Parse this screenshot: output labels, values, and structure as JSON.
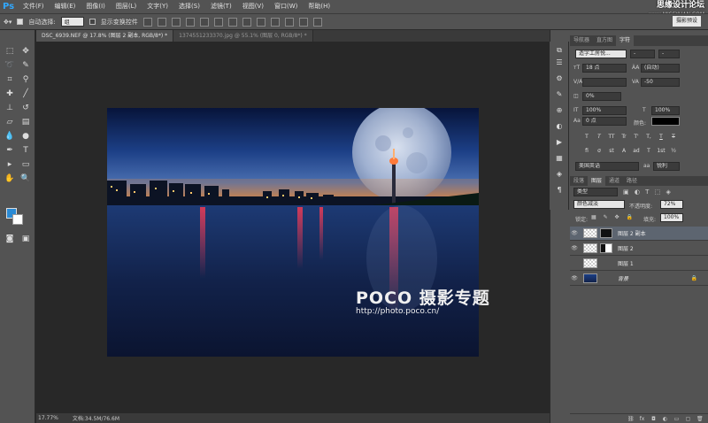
{
  "app": {
    "logo": "Ps"
  },
  "menu": [
    "文件(F)",
    "编辑(E)",
    "图像(I)",
    "图层(L)",
    "文字(Y)",
    "选择(S)",
    "滤镜(T)",
    "视图(V)",
    "窗口(W)",
    "帮助(H)"
  ],
  "watermark": {
    "title": "思缘设计论坛",
    "url": "www.MISSYUAN.COM"
  },
  "options": {
    "auto_select_label": "自动选择:",
    "auto_select_value": "组",
    "show_transform_label": "显示变换控件"
  },
  "workspace": {
    "value": "摄影预设"
  },
  "tabs": [
    {
      "label": "DSC_6939.NEF @ 17.8% (图层 2 副本, RGB/8*) *",
      "active": true
    },
    {
      "label": "1374551233370.jpg @ 55.1% (图层 0, RGB/8*) *",
      "active": false
    }
  ],
  "canvas": {
    "poco_brand": "POCO 摄影专题",
    "poco_url": "http://photo.poco.cn/"
  },
  "status": {
    "zoom": "17.77%",
    "doc": "文档:34.5M/76.6M"
  },
  "character_panel": {
    "tabs": [
      "导航器",
      "直方图",
      "字符"
    ],
    "font_family": "造字工房悦...",
    "font_size": "18 点",
    "leading": "(自动)",
    "tracking": "-50",
    "kerning": "0%",
    "vscale": "100%",
    "hscale": "100%",
    "baseline": "0 点",
    "color_label": "颜色:",
    "style_buttons": [
      "T",
      "T",
      "TT",
      "Tr",
      "T'",
      "T,",
      "T",
      "T"
    ],
    "feature_buttons": [
      "fi",
      "σ",
      "st",
      "A",
      "ad",
      "T",
      "1st",
      "½"
    ],
    "language": "美国英语",
    "aa_label": "aa",
    "aa_value": "锐利"
  },
  "layers_panel": {
    "tabs": [
      "段落",
      "图层",
      "通道",
      "路径"
    ],
    "kind_filter": "类型",
    "blend_mode": "颜色减淡",
    "opacity_label": "不透明度:",
    "opacity": "72%",
    "lock_label": "锁定:",
    "fill_label": "填充:",
    "fill": "100%",
    "layers": [
      {
        "name": "图层 2 副本",
        "selected": true,
        "visible": true,
        "has_mask": true
      },
      {
        "name": "图层 2",
        "selected": false,
        "visible": true,
        "has_mask": true
      },
      {
        "name": "图层 1",
        "selected": false,
        "visible": false,
        "has_mask": false
      },
      {
        "name": "背景",
        "selected": false,
        "visible": true,
        "has_mask": false,
        "locked": true
      }
    ]
  },
  "colors": {
    "foreground": "#2a8ad4",
    "background": "#ffffff",
    "accent": "#31a8ff"
  }
}
